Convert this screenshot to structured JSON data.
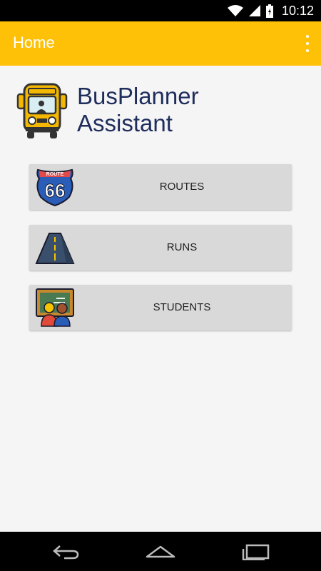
{
  "status_bar": {
    "time": "10:12",
    "icons": [
      "wifi-icon",
      "signal-icon",
      "battery-icon"
    ]
  },
  "app_bar": {
    "title": "Home",
    "menu_icon": "more-vert-icon"
  },
  "hero": {
    "app_name_line1": "BusPlanner",
    "app_name_line2": "Assistant",
    "logo_icon": "school-bus-icon"
  },
  "menu": [
    {
      "label": "ROUTES",
      "icon": "route-66-shield-icon"
    },
    {
      "label": "RUNS",
      "icon": "road-icon"
    },
    {
      "label": "STUDENTS",
      "icon": "students-chalkboard-icon"
    }
  ],
  "nav_bar": {
    "icons": [
      "back-icon",
      "home-icon",
      "recents-icon"
    ]
  },
  "colors": {
    "accent": "#ffc107",
    "title_text": "#1e2d5c",
    "button_bg": "#d9d9d9",
    "background": "#f5f5f5"
  }
}
